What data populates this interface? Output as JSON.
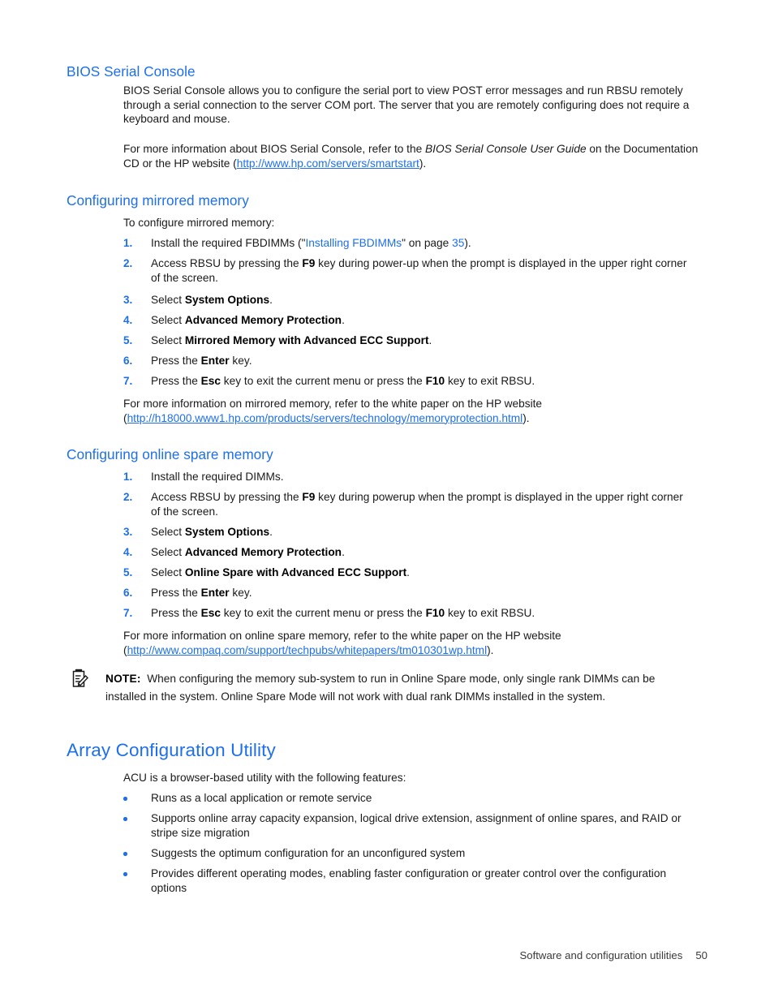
{
  "document": {
    "sections": {
      "bios_serial_console": {
        "heading": "BIOS Serial Console",
        "para1": "BIOS Serial Console allows you to configure the serial port to view POST error messages and run RBSU remotely through a serial connection to the server COM port. The server that you are remotely configuring does not require a keyboard and mouse.",
        "para2_a": "For more information about BIOS Serial Console, refer to the ",
        "para2_italic": "BIOS Serial Console User Guide",
        "para2_b": " on the Documentation CD or the HP website (",
        "para2_link": "http://www.hp.com/servers/smartstart",
        "para2_c": ")."
      },
      "configuring_mirrored_memory": {
        "heading": "Configuring mirrored memory",
        "intro": "To configure mirrored memory:",
        "steps": [
          {
            "number": "1.",
            "text_a": "Install the required FBDIMMs (\"",
            "xref": "Installing FBDIMMs",
            "text_b": "\" on page ",
            "page_ref": "35",
            "text_c": ")."
          },
          {
            "number": "2.",
            "text_a": "Access RBSU by pressing the ",
            "bold": "F9",
            "text_b": " key during power-up when the prompt is displayed in the upper right corner of the screen."
          },
          {
            "number": "3.",
            "text_a": "Select ",
            "bold": "System Options",
            "text_b": "."
          },
          {
            "number": "4.",
            "text_a": "Select ",
            "bold": "Advanced Memory Protection",
            "text_b": "."
          },
          {
            "number": "5.",
            "text_a": "Select ",
            "bold": "Mirrored Memory with Advanced ECC Support",
            "text_b": "."
          },
          {
            "number": "6.",
            "text_a": "Press the ",
            "bold": "Enter",
            "text_b": " key."
          },
          {
            "number": "7.",
            "text_a": "Press the ",
            "bold": "Esc",
            "text_b": " key to exit the current menu or press the ",
            "bold2": "F10",
            "text_c": " key to exit RBSU."
          }
        ],
        "closing_a": "For more information on mirrored memory, refer to the white paper on the HP website",
        "closing_open_paren": "(",
        "closing_link": "http://h18000.www1.hp.com/products/servers/technology/memoryprotection.html",
        "closing_close_paren": ")."
      },
      "configuring_online_spare_memory": {
        "heading": "Configuring online spare memory",
        "steps": [
          {
            "number": "1.",
            "text_a": "Install the required DIMMs."
          },
          {
            "number": "2.",
            "text_a": "Access RBSU by pressing the ",
            "bold": "F9",
            "text_b": " key during powerup when the prompt is displayed in the upper right corner of the screen."
          },
          {
            "number": "3.",
            "text_a": "Select ",
            "bold": "System Options",
            "text_b": "."
          },
          {
            "number": "4.",
            "text_a": "Select ",
            "bold": "Advanced Memory Protection",
            "text_b": "."
          },
          {
            "number": "5.",
            "text_a": "Select ",
            "bold": "Online Spare with Advanced ECC Support",
            "text_b": "."
          },
          {
            "number": "6.",
            "text_a": "Press the ",
            "bold": "Enter",
            "text_b": " key."
          },
          {
            "number": "7.",
            "text_a": "Press the ",
            "bold": "Esc",
            "text_b": " key to exit the current menu or press the ",
            "bold2": "F10",
            "text_c": " key to exit RBSU."
          }
        ],
        "closing_a": "For more information on online spare memory, refer to the white paper on the HP website",
        "closing_open_paren": "(",
        "closing_link": "http://www.compaq.com/support/techpubs/whitepapers/tm010301wp.html",
        "closing_close_paren": ")."
      },
      "note": {
        "icon": "note-clipboard-pencil-icon",
        "label": "NOTE:",
        "text": "When configuring the memory sub-system to run in Online Spare mode, only single rank DIMMs can be installed in the system.  Online Spare Mode will not work with dual rank DIMMs installed in the system."
      },
      "array_configuration_utility": {
        "heading": "Array Configuration Utility",
        "intro": "ACU is a browser-based utility with the following features:",
        "bullets": [
          "Runs as a local application or remote service",
          "Supports online array capacity expansion, logical drive extension, assignment of online spares, and RAID or stripe size migration",
          "Suggests the optimum configuration for an unconfigured system",
          "Provides different operating modes, enabling faster configuration or greater control over the configuration options"
        ]
      }
    },
    "footer": {
      "chapter": "Software and configuration utilities",
      "page_number": "50"
    },
    "colors": {
      "heading_blue": "#1e6feb",
      "link_blue": "#1e6feb",
      "body_text": "#1a1a1a"
    }
  }
}
